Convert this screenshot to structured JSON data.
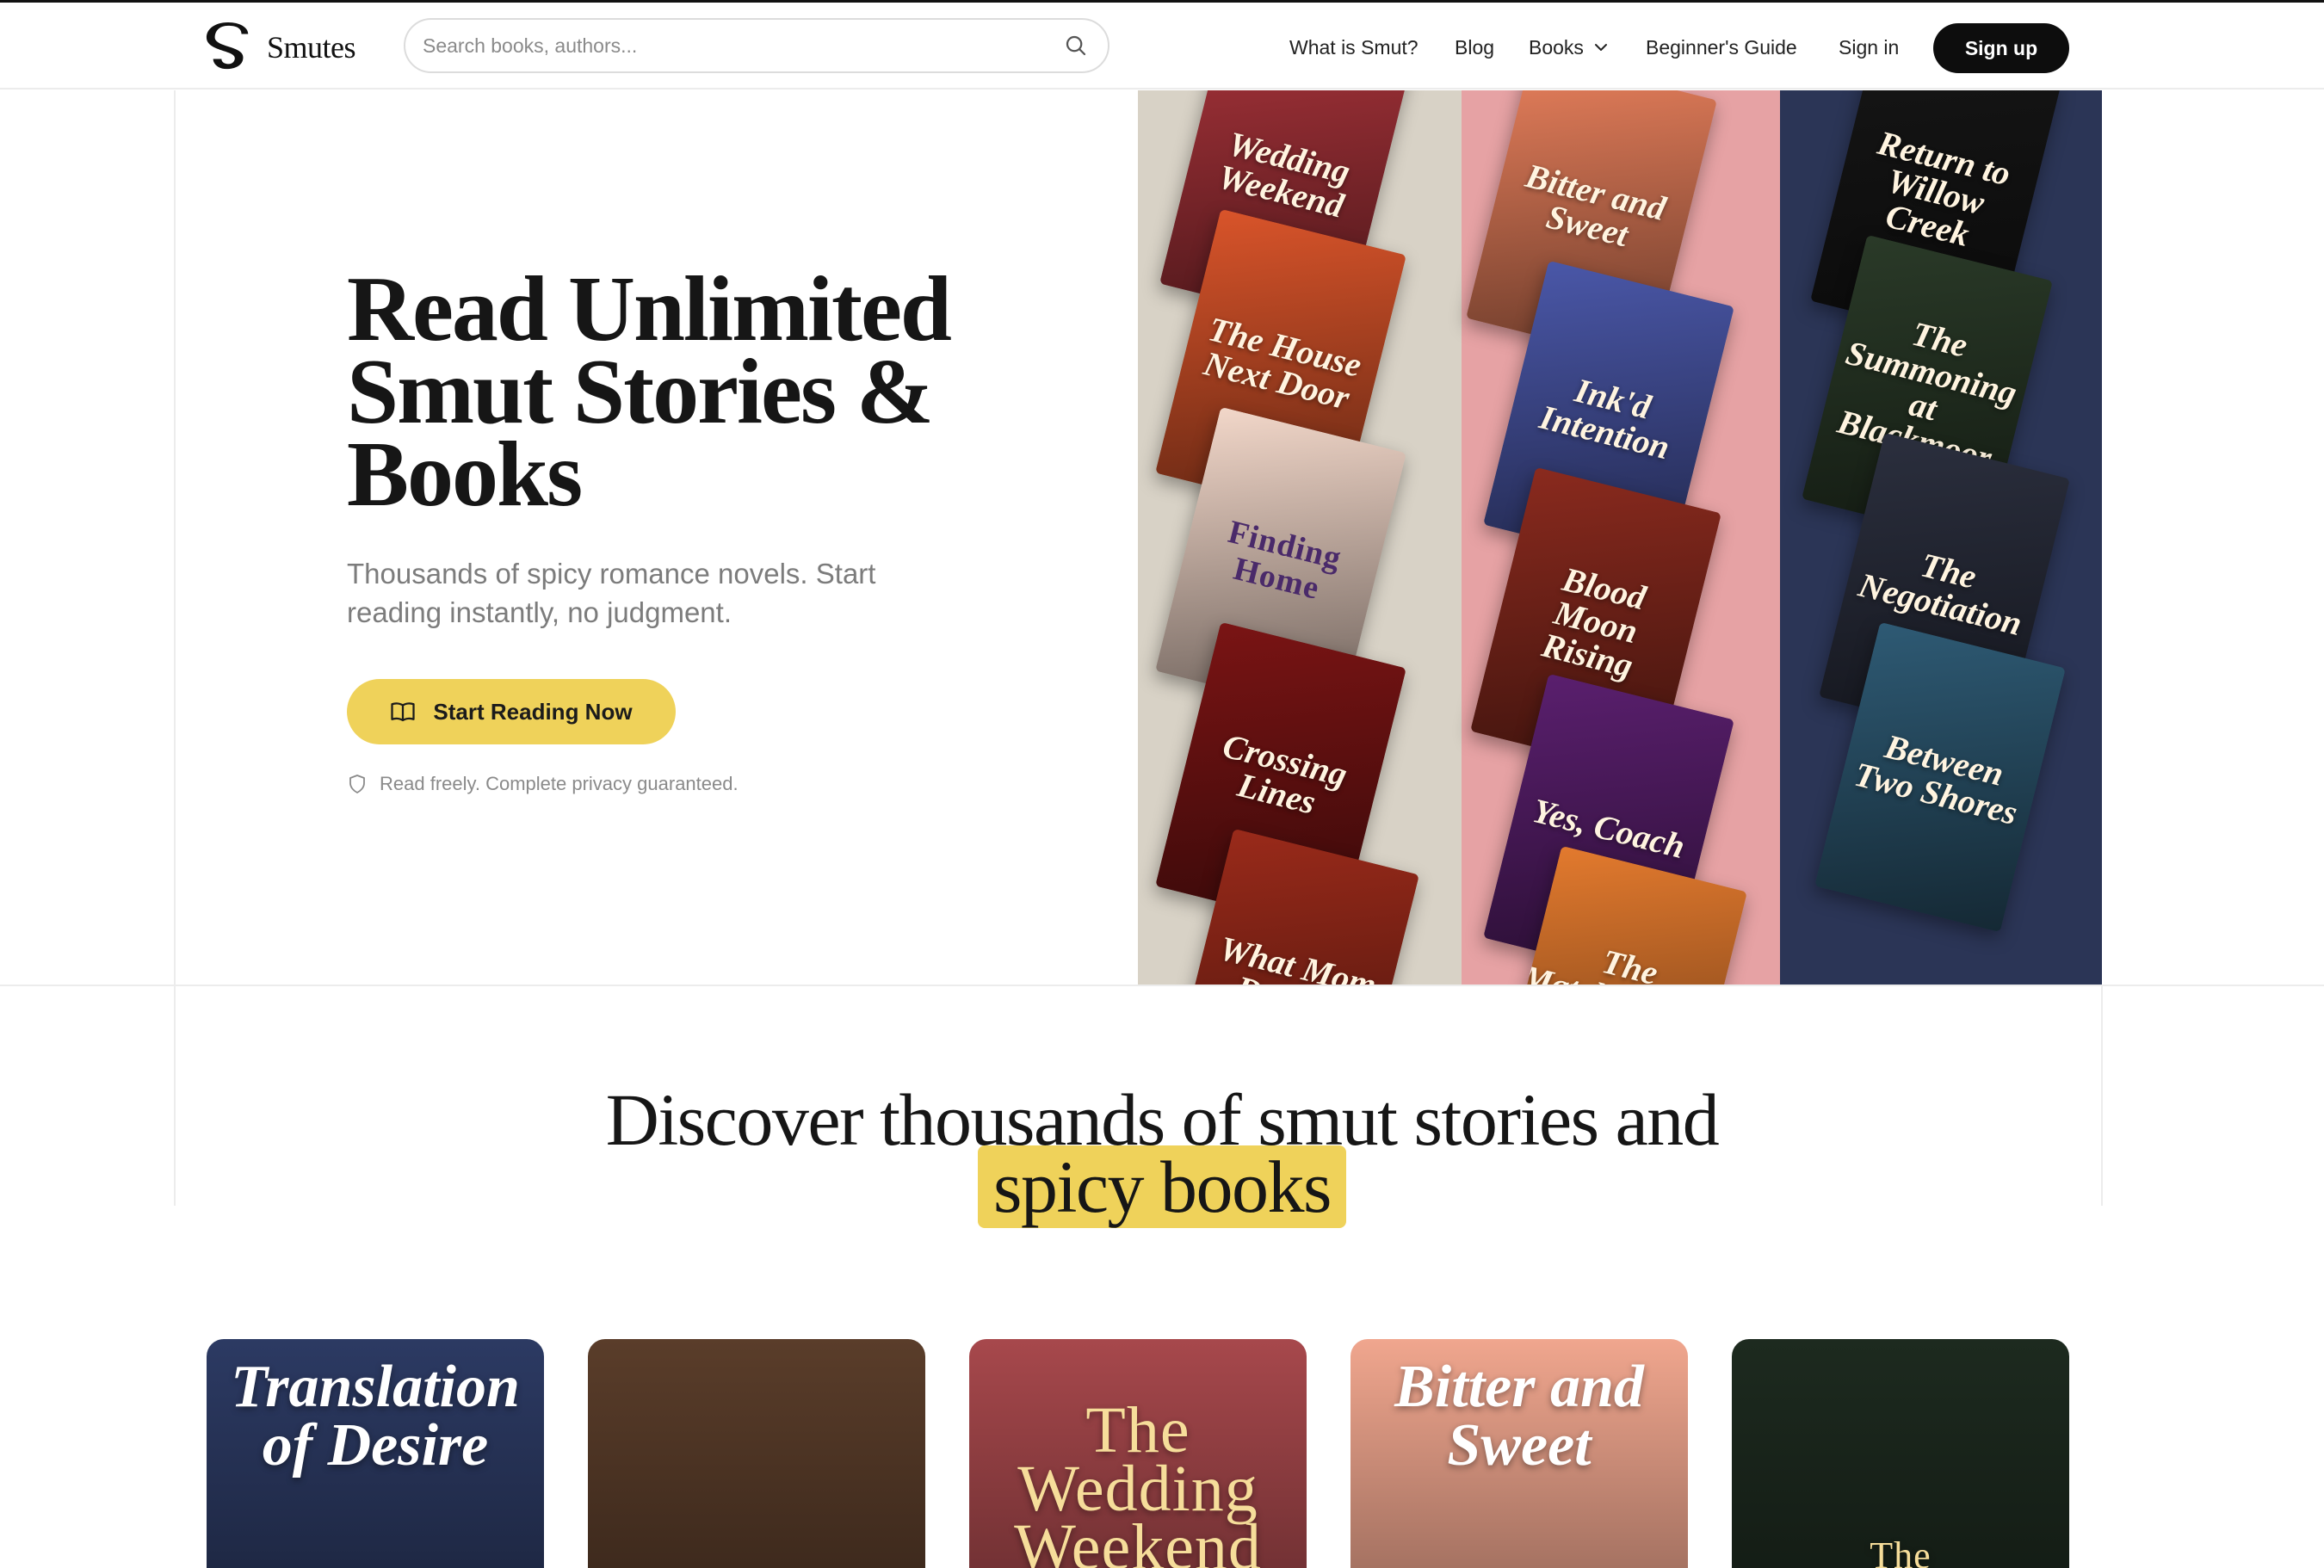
{
  "brand": {
    "name": "Smutes"
  },
  "search": {
    "placeholder": "Search books, authors..."
  },
  "nav": {
    "what_is": "What is Smut?",
    "blog": "Blog",
    "books": "Books",
    "guide": "Beginner's Guide",
    "sign_in": "Sign in",
    "sign_up": "Sign up"
  },
  "hero": {
    "title": "Read Unlimited Smut Stories & Books",
    "subtitle": "Thousands of spicy romance novels. Start reading instantly, no judgment.",
    "cta": "Start Reading Now",
    "privacy": "Read freely. Complete privacy guaranteed."
  },
  "collage": {
    "col1_bg": "#d8d2c6",
    "col2_bg": "#e6a2a4",
    "col3_bg": "#2b3556",
    "col1": [
      {
        "title": "Wedding Weekend",
        "color": "#a8333a"
      },
      {
        "title": "The House Next Door",
        "color": "#d9542a"
      },
      {
        "title": "Finding Home",
        "color": "#f2d7c9"
      },
      {
        "title": "Crossing Lines",
        "color": "#7a1414"
      },
      {
        "title": "What Mom Doesn't",
        "color": "#9a2a1a"
      }
    ],
    "col2": [
      {
        "title": "Bitter and Sweet",
        "color": "#e9805c"
      },
      {
        "title": "Ink'd Intention",
        "color": "#4a57a8"
      },
      {
        "title": "Blood Moon Rising",
        "color": "#8a2a1e"
      },
      {
        "title": "Yes, Coach",
        "color": "#5a1f6e"
      },
      {
        "title": "The Matchmaker's Daughter",
        "color": "#e37a2e"
      }
    ],
    "col3": [
      {
        "title": "Return to Willow Creek",
        "color": "#161616"
      },
      {
        "title": "The Summoning at Blackmoor",
        "color": "#2a3a28"
      },
      {
        "title": "The Negotiation",
        "color": "#2b2f3e"
      },
      {
        "title": "Between Two Shores",
        "color": "#2e5a74"
      }
    ]
  },
  "discover": {
    "line1": "Discover thousands of smut stories and",
    "highlight": "spicy books"
  },
  "books": [
    {
      "title": "Translation of Desire",
      "color": "#2c3a63"
    },
    {
      "title": "",
      "color": "#5a3d2a"
    },
    {
      "title": "The Wedding Weekend",
      "color": "#a7484c"
    },
    {
      "title": "Bitter and Sweet",
      "color": "#f0a68e"
    },
    {
      "title": "The",
      "color": "#1d2a1f"
    }
  ],
  "colors": {
    "accent": "#efd25a",
    "primary": "#0d0d0d"
  }
}
